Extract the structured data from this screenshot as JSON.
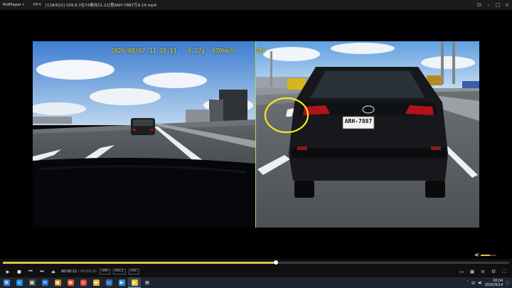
{
  "window": {
    "app_name": "PotPlayer",
    "menu_label": "MP4",
    "file_title": "[118/622] 109.8.7在74東向11.2公里ARH-7887万9.14.mp4",
    "minimize_icon": "minimize-icon",
    "maximize_icon": "maximize-icon",
    "close_icon": "close-icon"
  },
  "overlay": {
    "date": "2020/08/07",
    "time": "11:18:11",
    "g_value": "0.27g",
    "speed": "079km/h",
    "extra": "+0103m"
  },
  "rear_plate": "ARH-7887",
  "colors": {
    "highlight_circle": "#f5ea1a",
    "osd_text": "#f2e41b",
    "seek_accent": "#e3c14a",
    "camera_divider": "#b7d44a"
  },
  "player": {
    "progress": 0.54,
    "volume": 0.6,
    "current_time": "00:00:11",
    "duration": "00:00:20",
    "tags": [
      "S/W",
      "AVC1",
      "AAC"
    ]
  },
  "taskbar": {
    "apps": [
      {
        "name": "start",
        "glyph": "⊞",
        "color": "#3a86d8"
      },
      {
        "name": "edge",
        "glyph": "e",
        "color": "#1e8ed8"
      },
      {
        "name": "store",
        "glyph": "▦",
        "color": "#555"
      },
      {
        "name": "mail",
        "glyph": "✉",
        "color": "#1f6fc2"
      },
      {
        "name": "photos",
        "glyph": "▣",
        "color": "#d88b22"
      },
      {
        "name": "firefox",
        "glyph": "◉",
        "color": "#e25d28"
      },
      {
        "name": "chrome",
        "glyph": "◎",
        "color": "#d7453a"
      },
      {
        "name": "explorer",
        "glyph": "▬",
        "color": "#e0b530"
      },
      {
        "name": "screen",
        "glyph": "▭",
        "color": "#3a6ea8"
      },
      {
        "name": "media",
        "glyph": "▶",
        "color": "#2a8fd8"
      },
      {
        "name": "potplayer",
        "glyph": "▶",
        "color": "#e9c32a"
      },
      {
        "name": "terminal",
        "glyph": "▤",
        "color": "#1d2b3d"
      }
    ],
    "clock_time": "10:04",
    "clock_date": "2020/9/14"
  }
}
